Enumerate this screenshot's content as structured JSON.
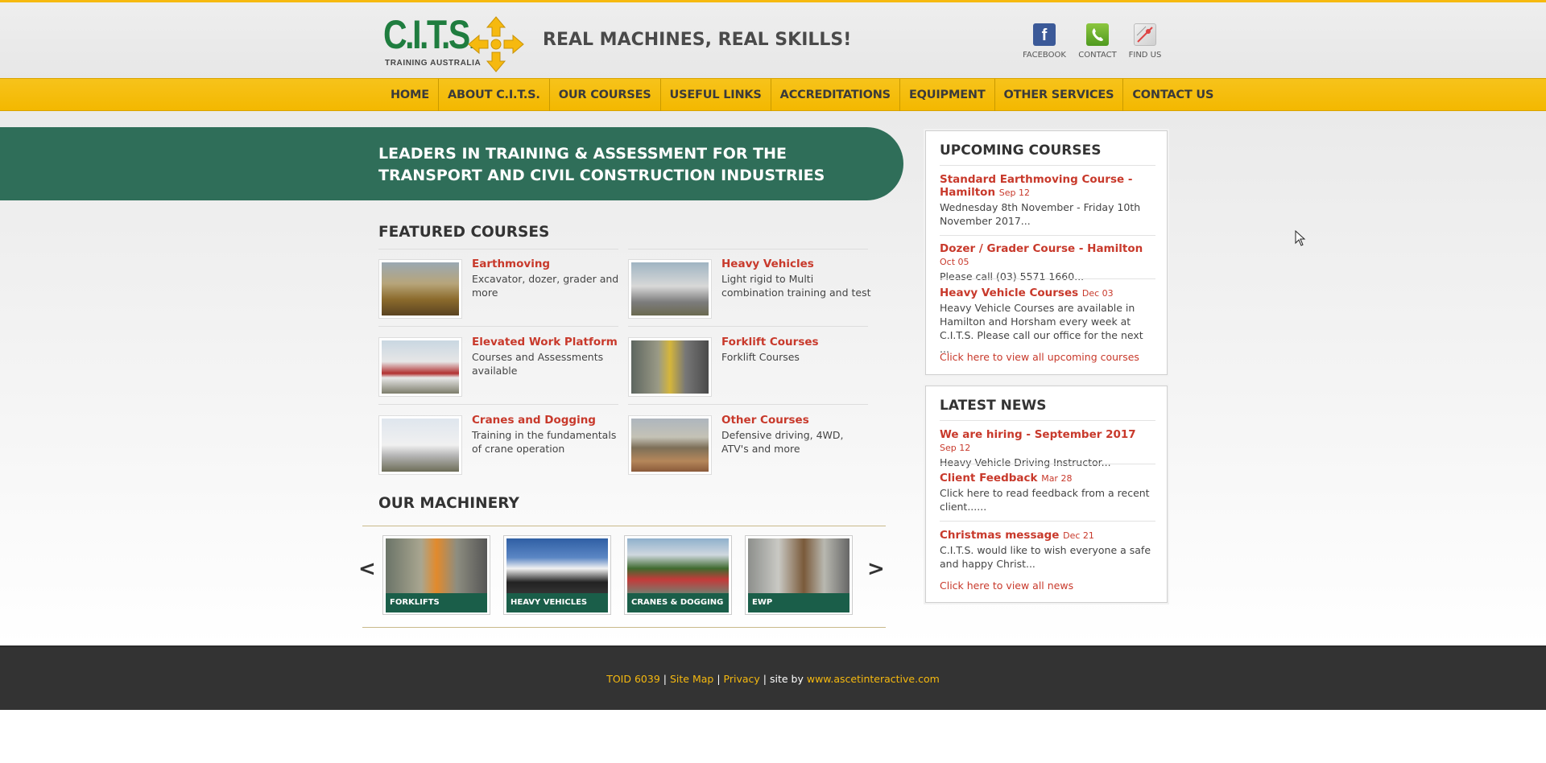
{
  "header": {
    "logo_text": "C.I.T.S.",
    "logo_sub": "TRAINING AUSTRALIA",
    "tagline": "REAL MACHINES, REAL SKILLS!",
    "social": [
      {
        "label": "FACEBOOK",
        "icon": "facebook-icon"
      },
      {
        "label": "CONTACT",
        "icon": "phone-icon"
      },
      {
        "label": "FIND US",
        "icon": "map-icon"
      }
    ]
  },
  "nav": [
    "HOME",
    "ABOUT C.I.T.S.",
    "OUR COURSES",
    "USEFUL LINKS",
    "ACCREDITATIONS",
    "EQUIPMENT",
    "OTHER SERVICES",
    "CONTACT US"
  ],
  "banner": {
    "line1": "LEADERS IN TRAINING & ASSESSMENT FOR THE",
    "line2": "TRANSPORT AND CIVIL CONSTRUCTION INDUSTRIES"
  },
  "featured": {
    "title": "FEATURED COURSES",
    "courses": [
      {
        "title": "Earthmoving",
        "desc": "Excavator, dozer, grader and more"
      },
      {
        "title": "Heavy Vehicles",
        "desc": "Light rigid to Multi combination training and test"
      },
      {
        "title": "Elevated Work Platform",
        "desc": "Courses and Assessments available"
      },
      {
        "title": "Forklift Courses",
        "desc": "Forklift Courses"
      },
      {
        "title": "Cranes and Dogging",
        "desc": "Training in the fundamentals of crane operation"
      },
      {
        "title": "Other Courses",
        "desc": "Defensive driving, 4WD, ATV's and more"
      }
    ]
  },
  "machinery": {
    "title": "OUR MACHINERY",
    "prev": "<",
    "next": ">",
    "items": [
      "FORKLIFTS",
      "HEAVY VEHICLES",
      "CRANES & DOGGING",
      "EWP"
    ]
  },
  "upcoming": {
    "title": "UPCOMING COURSES",
    "items": [
      {
        "title": "Standard Earthmoving Course - Hamilton",
        "date": "Sep 12",
        "desc": "Wednesday 8th November - Friday 10th November 2017..."
      },
      {
        "title": "Dozer / Grader Course - Hamilton",
        "date": "Oct 05",
        "desc": "Please call (03) 5571 1660..."
      },
      {
        "title": "Heavy Vehicle Courses",
        "date": "Dec 03",
        "desc": "Heavy Vehicle Courses are available in Hamilton and Horsham every week at C.I.T.S. Please call our office for the next ..."
      }
    ],
    "link": "Click here to view all upcoming courses"
  },
  "news": {
    "title": "LATEST NEWS",
    "items": [
      {
        "title": "We are hiring - September 2017",
        "date": "Sep 12",
        "desc": "Heavy Vehicle Driving Instructor..."
      },
      {
        "title": "Client Feedback",
        "date": "Mar 28",
        "desc": "Click here to read feedback from a recent client......"
      },
      {
        "title": "Christmas message",
        "date": "Dec 21",
        "desc": "C.I.T.S. would like to wish everyone a safe and happy Christ..."
      }
    ],
    "link": "Click here to view all news"
  },
  "footer": {
    "toid": "TOID 6039",
    "sep": "|",
    "sitemap": "Site Map",
    "privacy": "Privacy",
    "siteby": "site by",
    "url": "www.ascetinteractive.com"
  },
  "colors": {
    "accent_yellow": "#f6b90f",
    "brand_green": "#2f6e59",
    "link_red": "#c8392b",
    "footer_bg": "#333333"
  }
}
